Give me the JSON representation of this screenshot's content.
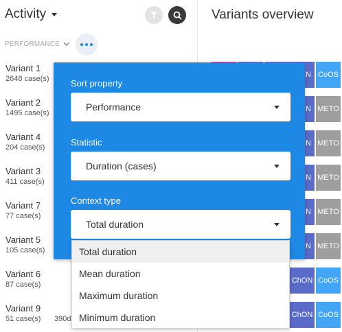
{
  "left": {
    "title": "Activity",
    "sort_label": "PERFORMANCE",
    "variants": [
      {
        "name": "Variant 1",
        "cases": "2648 case(s)"
      },
      {
        "name": "Variant 2",
        "cases": "1495 case(s)"
      },
      {
        "name": "Variant 4",
        "cases": "204 case(s)"
      },
      {
        "name": "Variant 3",
        "cases": "411 case(s)"
      },
      {
        "name": "Variant 7",
        "cases": "77 case(s)"
      },
      {
        "name": "Variant 5",
        "cases": "105 case(s)"
      },
      {
        "name": "Variant 6",
        "cases": "87 case(s)"
      },
      {
        "name": "Variant 9",
        "cases": "51 case(s)"
      }
    ],
    "extra_text": "390d"
  },
  "right": {
    "title": "Variants overview",
    "chips": {
      "coos": "CoOS",
      "n": "N",
      "meto": "METO",
      "chon": "ChON"
    }
  },
  "popup": {
    "sort_property_label": "Sort property",
    "sort_property_value": "Performance",
    "statistic_label": "Statistic",
    "statistic_value": "Duration (cases)",
    "context_label": "Context type",
    "context_value": "Total duration",
    "options": [
      "Total duration",
      "Mean duration",
      "Maximum duration",
      "Minimum duration"
    ]
  },
  "colors": {
    "accent": "#1e88e5",
    "chip_purple": "#5b6bc8",
    "chip_grey": "#9e9e9e",
    "chip_blue": "#42a5f5"
  }
}
